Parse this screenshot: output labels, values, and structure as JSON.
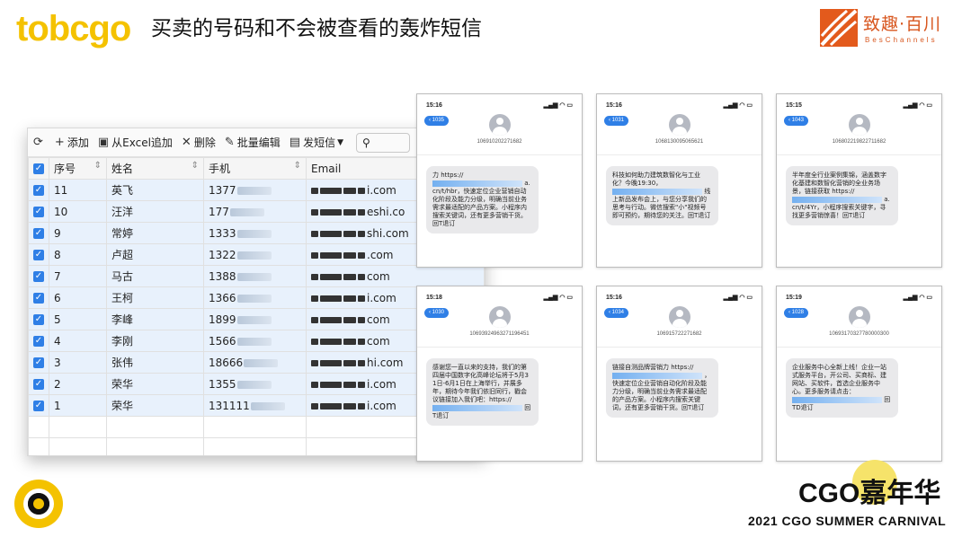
{
  "header": {
    "logo": "tobcgo",
    "title": "买卖的号码和不会被查看的轰炸短信",
    "brand_name": "致趣·百川",
    "brand_sub": "BesChannels"
  },
  "toolbar": {
    "refresh_icon": "refresh-icon",
    "add_label": "添加",
    "import_label": "从Excel追加",
    "delete_label": "删除",
    "batch_edit_label": "批量编辑",
    "send_sms_label": "发短信",
    "search_placeholder": ""
  },
  "table": {
    "columns": [
      "序号",
      "姓名",
      "手机",
      "Email"
    ],
    "rows": [
      {
        "id": "11",
        "name": "英飞",
        "phone": "1377",
        "email": "i.com"
      },
      {
        "id": "10",
        "name": "汪洋",
        "phone": "177",
        "email": "eshi.co"
      },
      {
        "id": "9",
        "name": "常婷",
        "phone": "1333",
        "email": "shi.com"
      },
      {
        "id": "8",
        "name": "卢超",
        "phone": "1322",
        "email": ".com"
      },
      {
        "id": "7",
        "name": "马古",
        "phone": "1388",
        "email": "com"
      },
      {
        "id": "6",
        "name": "王柯",
        "phone": "1366",
        "email": "i.com"
      },
      {
        "id": "5",
        "name": "李峰",
        "phone": "1899",
        "email": "com"
      },
      {
        "id": "4",
        "name": "李刚",
        "phone": "1566",
        "email": "com"
      },
      {
        "id": "3",
        "name": "张伟",
        "phone": "18666",
        "email": "hi.com"
      },
      {
        "id": "2",
        "name": "荣华",
        "phone": "1355",
        "email": "i.com"
      },
      {
        "id": "1",
        "name": "荣华",
        "phone": "131111",
        "email": "i.com"
      }
    ]
  },
  "phones": [
    {
      "time": "15:16",
      "back": "1035",
      "number": "106910202271682",
      "text1": "力 https://",
      "text2": "a.cn/t/hbr，快速定位企业营销自动化阶段及能力分级，明确当前业务需求最适配的产品方案。小程序内搜索关键词，还有更多营销干货。回T退订"
    },
    {
      "time": "15:16",
      "back": "1031",
      "number": "1068130095065621",
      "text1": "科技如何助力建筑数智化与工业化？今晚19:30，",
      "text2": "线上新品发布会上，与您分享我们的思考与行动。微信搜索\"小\"视频号即可预约，期待您的关注。回T退订"
    },
    {
      "time": "15:15",
      "back": "1043",
      "number": "106802219822711682",
      "text1": "半年度全行业案例集锦，涵盖数字化基建和数智化营销的全业务场景，链接获取 https://",
      "text2": "a.cn/t/4Yr，小程序搜索关键字，寻找更多营销惊喜！回T退订"
    },
    {
      "time": "15:18",
      "back": "1030",
      "number": "10693924963271196451",
      "text1": "感谢您一直以来的支持，我们的第四届中国数字化高峰论坛将于5月31日-6月1日在上海举行，并展多年，期待今年我们依旧同行，戳会议链接加入我们吧：https://",
      "text2": "回T退订"
    },
    {
      "time": "15:16",
      "back": "1034",
      "number": "106915722271682",
      "text1": "链接自测品牌营销力 https://",
      "text2": "，快速定位企业营销自动化阶段及能力分级，明确当前业务需求最适配的产品方案。小程序内搜索关键词，还有更多营销干货。回T退订"
    },
    {
      "time": "15:19",
      "back": "1028",
      "number": "10693170327780000300",
      "text1": "企业服务中心全新上线！企业一站式服务平台，开公司、买商标、建网站、买软件，首选企业服务中心。更多服务请点击：",
      "text2": "回TD退订"
    }
  ],
  "footer": {
    "carnival_title": "CGO嘉年华",
    "carnival_sub": "2021 CGO SUMMER CARNIVAL"
  }
}
